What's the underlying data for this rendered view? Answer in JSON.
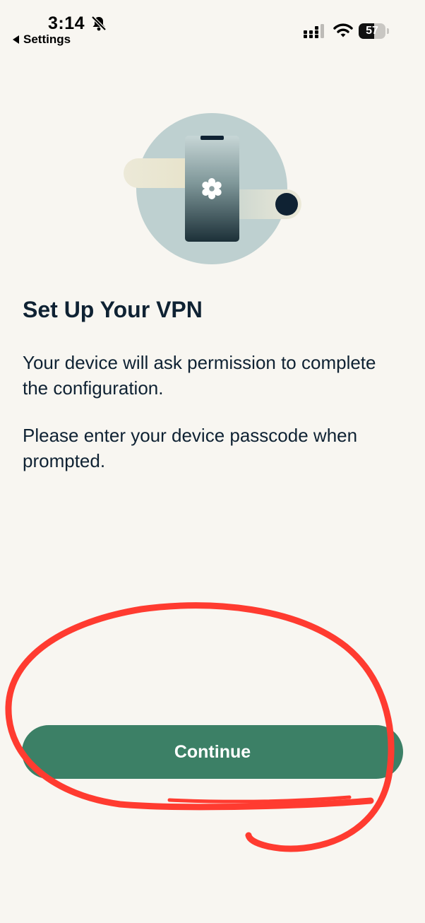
{
  "status_bar": {
    "time": "3:14",
    "back_label": "Settings",
    "battery_level": "57",
    "battery_fraction": 0.57
  },
  "icons": {
    "bell": "bell-slash-icon",
    "signal": "cellular-signal-icon",
    "wifi": "wifi-icon",
    "battery": "battery-icon",
    "illustration": "phone-settings-illustration",
    "gear": "gear-icon"
  },
  "screen": {
    "title": "Set Up Your VPN",
    "paragraph_1": "Your device will ask permission to complete the configuration.",
    "paragraph_2": "Please enter your device passcode when prompted."
  },
  "actions": {
    "continue_label": "Continue"
  },
  "colors": {
    "background": "#f8f6f1",
    "text": "#0f2233",
    "button": "#3c8066",
    "annotation": "#ff3b30"
  }
}
